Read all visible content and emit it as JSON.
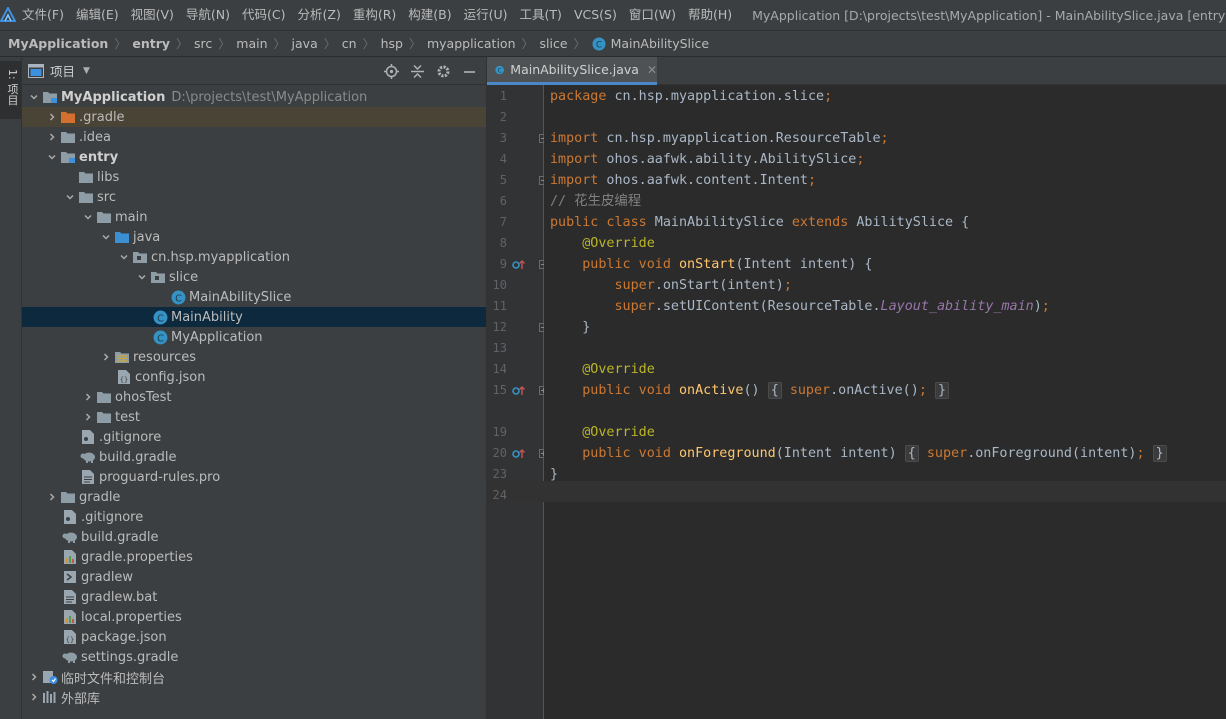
{
  "colors": {
    "accent": "#4a88c7",
    "selection": "#0d293e",
    "gradle_highlight": "#4a4437",
    "keyword": "#cc7832",
    "annotation": "#bbb529",
    "function": "#ffc66d",
    "comment": "#808080",
    "field": "#9876aa"
  },
  "menubar": {
    "items": [
      "文件(F)",
      "编辑(E)",
      "视图(V)",
      "导航(N)",
      "代码(C)",
      "分析(Z)",
      "重构(R)",
      "构建(B)",
      "运行(U)",
      "工具(T)",
      "VCS(S)",
      "窗口(W)",
      "帮助(H)"
    ],
    "window_title": "MyApplication [D:\\projects\\test\\MyApplication] - MainAbilitySlice.java [entry]"
  },
  "breadcrumb": [
    "MyApplication",
    "entry",
    "src",
    "main",
    "java",
    "cn",
    "hsp",
    "myapplication",
    "slice",
    "MainAbilitySlice"
  ],
  "tool_stripe": {
    "label": "1: 项目"
  },
  "project_panel": {
    "title": "项目"
  },
  "tree": [
    {
      "label": "MyApplication",
      "path": "D:\\projects\\test\\MyApplication",
      "icon": "module-folder-icon"
    },
    {
      "label": ".gradle",
      "icon": "orange-folder-icon"
    },
    {
      "label": ".idea",
      "icon": "folder-icon"
    },
    {
      "label": "entry",
      "icon": "module-folder-icon"
    },
    {
      "label": "libs",
      "icon": "folder-icon"
    },
    {
      "label": "src",
      "icon": "folder-icon"
    },
    {
      "label": "main",
      "icon": "folder-icon"
    },
    {
      "label": "java",
      "icon": "source-folder-icon"
    },
    {
      "label": "cn.hsp.myapplication",
      "icon": "package-icon"
    },
    {
      "label": "slice",
      "icon": "package-icon"
    },
    {
      "label": "MainAbilitySlice",
      "icon": "java-class-icon"
    },
    {
      "label": "MainAbility",
      "icon": "java-class-icon"
    },
    {
      "label": "MyApplication",
      "icon": "java-class-icon"
    },
    {
      "label": "resources",
      "icon": "resources-folder-icon"
    },
    {
      "label": "config.json",
      "icon": "json-file-icon"
    },
    {
      "label": "ohosTest",
      "icon": "folder-icon"
    },
    {
      "label": "test",
      "icon": "folder-icon"
    },
    {
      "label": ".gitignore",
      "icon": "gitignore-file-icon"
    },
    {
      "label": "build.gradle",
      "icon": "gradle-elephant-icon"
    },
    {
      "label": "proguard-rules.pro",
      "icon": "text-file-icon"
    },
    {
      "label": "gradle",
      "icon": "folder-icon"
    },
    {
      "label": ".gitignore",
      "icon": "gitignore-file-icon"
    },
    {
      "label": "build.gradle",
      "icon": "gradle-elephant-icon"
    },
    {
      "label": "gradle.properties",
      "icon": "properties-file-icon"
    },
    {
      "label": "gradlew",
      "icon": "script-file-icon"
    },
    {
      "label": "gradlew.bat",
      "icon": "text-file-icon"
    },
    {
      "label": "local.properties",
      "icon": "properties-file-icon"
    },
    {
      "label": "package.json",
      "icon": "json-file-icon"
    },
    {
      "label": "settings.gradle",
      "icon": "gradle-elephant-icon"
    },
    {
      "label": "临时文件和控制台",
      "icon": "scratches-icon"
    },
    {
      "label": "外部库",
      "icon": "libraries-icon"
    }
  ],
  "editor": {
    "tab_label": "MainAbilitySlice.java",
    "line_numbers": [
      "1",
      "2",
      "3",
      "4",
      "5",
      "6",
      "7",
      "8",
      "9",
      "10",
      "11",
      "12",
      "13",
      "14",
      "15",
      "19",
      "20",
      "23",
      "24"
    ]
  }
}
